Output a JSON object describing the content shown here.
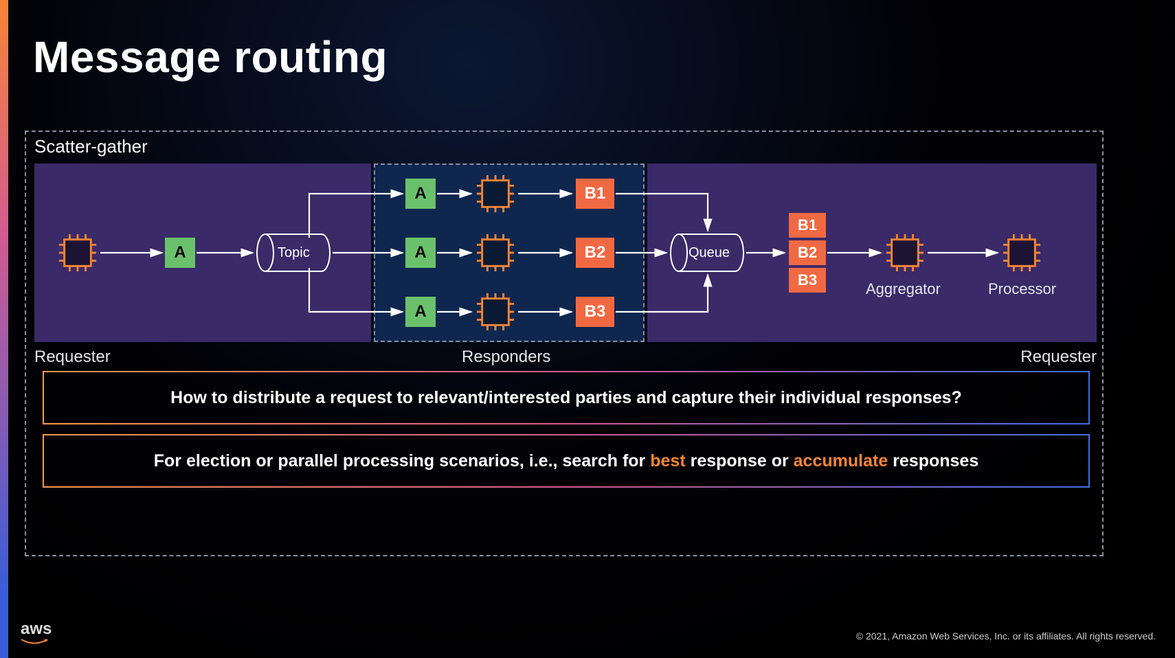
{
  "title": "Message routing",
  "outer_label": "Scatter-gather",
  "sections": {
    "requester": "Requester",
    "responders": "Responders",
    "requester2": "Requester"
  },
  "nodes": {
    "topic": "Topic",
    "queue": "Queue",
    "aggregator": "Aggregator",
    "processor": "Processor"
  },
  "messages": {
    "a": "A",
    "row1_a": "A",
    "row2_a": "A",
    "row3_a": "A",
    "b1": "B1",
    "b2": "B2",
    "b3": "B3",
    "stack_b1": "B1",
    "stack_b2": "B2",
    "stack_b3": "B3"
  },
  "pills": {
    "p1": "How to distribute a request to relevant/interested parties and capture their individual responses?",
    "p2_pre": "For election or parallel processing scenarios, i.e., search for ",
    "p2_best": "best",
    "p2_mid": " response or ",
    "p2_acc": "accumulate",
    "p2_post": " responses"
  },
  "footer": {
    "logo": "aws",
    "copyright": "© 2021, Amazon Web Services, Inc. or its affiliates. All rights reserved."
  },
  "colors": {
    "section_purple": "#3a2a68",
    "section_blue": "#0f274f",
    "msg_green": "#6bc16b",
    "msg_orange": "#f16943",
    "chip_orange": "#f58536"
  }
}
